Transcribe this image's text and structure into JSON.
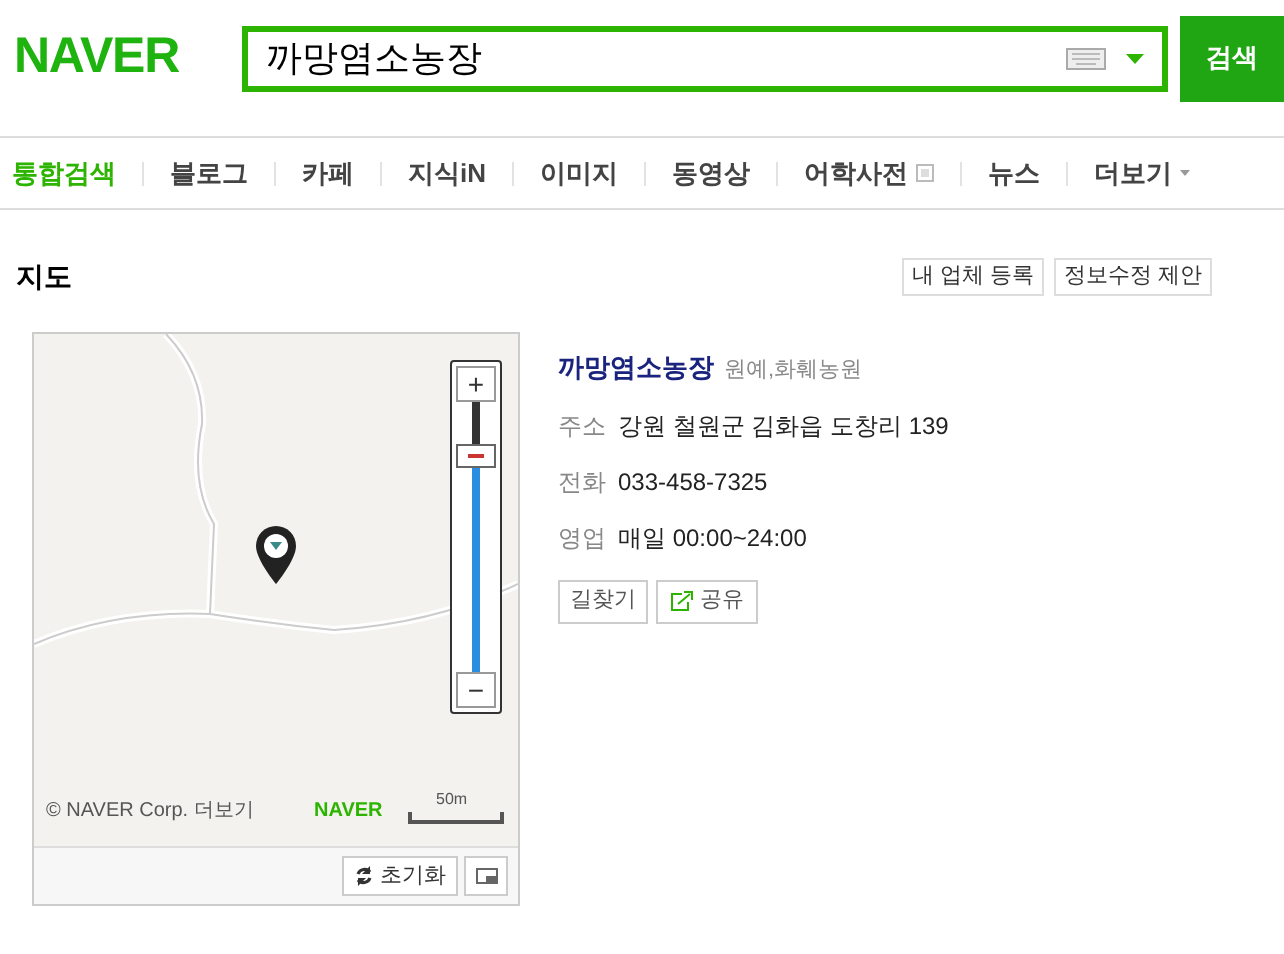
{
  "header": {
    "logo": "NAVER",
    "query": "까망염소농장",
    "search_button": "검색"
  },
  "tabs": [
    {
      "label": "통합검색",
      "selected": true,
      "kind": "plain"
    },
    {
      "label": "블로그",
      "selected": false,
      "kind": "plain"
    },
    {
      "label": "카페",
      "selected": false,
      "kind": "plain"
    },
    {
      "label": "지식iN",
      "selected": false,
      "kind": "plain"
    },
    {
      "label": "이미지",
      "selected": false,
      "kind": "plain"
    },
    {
      "label": "동영상",
      "selected": false,
      "kind": "plain"
    },
    {
      "label": "어학사전",
      "selected": false,
      "kind": "popup"
    },
    {
      "label": "뉴스",
      "selected": false,
      "kind": "plain"
    },
    {
      "label": "더보기",
      "selected": false,
      "kind": "more"
    }
  ],
  "section": {
    "title": "지도",
    "actions": [
      "내 업체 등록",
      "정보수정 제안"
    ]
  },
  "map": {
    "zoom": {
      "level": 0.8,
      "zoom_in": "+",
      "zoom_out": "−"
    },
    "copyright": "© NAVER Corp.",
    "more": "더보기",
    "logo": "NAVER",
    "scale": "50m",
    "reset": "초기화"
  },
  "place": {
    "name": "까망염소농장",
    "category": "원예,화훼농원",
    "details": [
      {
        "label": "주소",
        "value": "강원 철원군 김화읍 도창리 139"
      },
      {
        "label": "전화",
        "value": "033-458-7325"
      },
      {
        "label": "영업",
        "value": "매일 00:00~24:00"
      }
    ],
    "directions": "길찾기",
    "share": "공유"
  }
}
